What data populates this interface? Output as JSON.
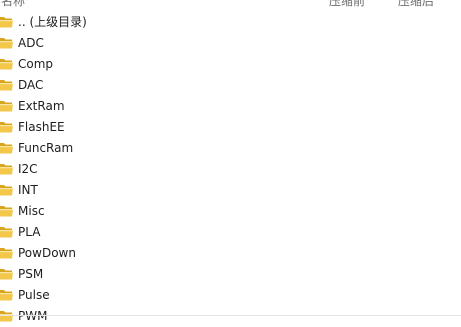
{
  "columns": {
    "name": "名称",
    "before_compress": "压缩前",
    "after_compress": "压缩后"
  },
  "folder_icon": "folder-icon",
  "items": [
    {
      "label": ".. (上级目录)"
    },
    {
      "label": "ADC"
    },
    {
      "label": "Comp"
    },
    {
      "label": "DAC"
    },
    {
      "label": "ExtRam"
    },
    {
      "label": "FlashEE"
    },
    {
      "label": "FuncRam"
    },
    {
      "label": "I2C"
    },
    {
      "label": "INT"
    },
    {
      "label": "Misc"
    },
    {
      "label": "PLA"
    },
    {
      "label": "PowDown"
    },
    {
      "label": "PSM"
    },
    {
      "label": "Pulse"
    },
    {
      "label": "PWM"
    }
  ],
  "colors": {
    "folder_fill": "#f3c74a",
    "folder_dark": "#d9a520",
    "folder_light": "#fbe6a0",
    "header_text": "#6d6d6d"
  }
}
